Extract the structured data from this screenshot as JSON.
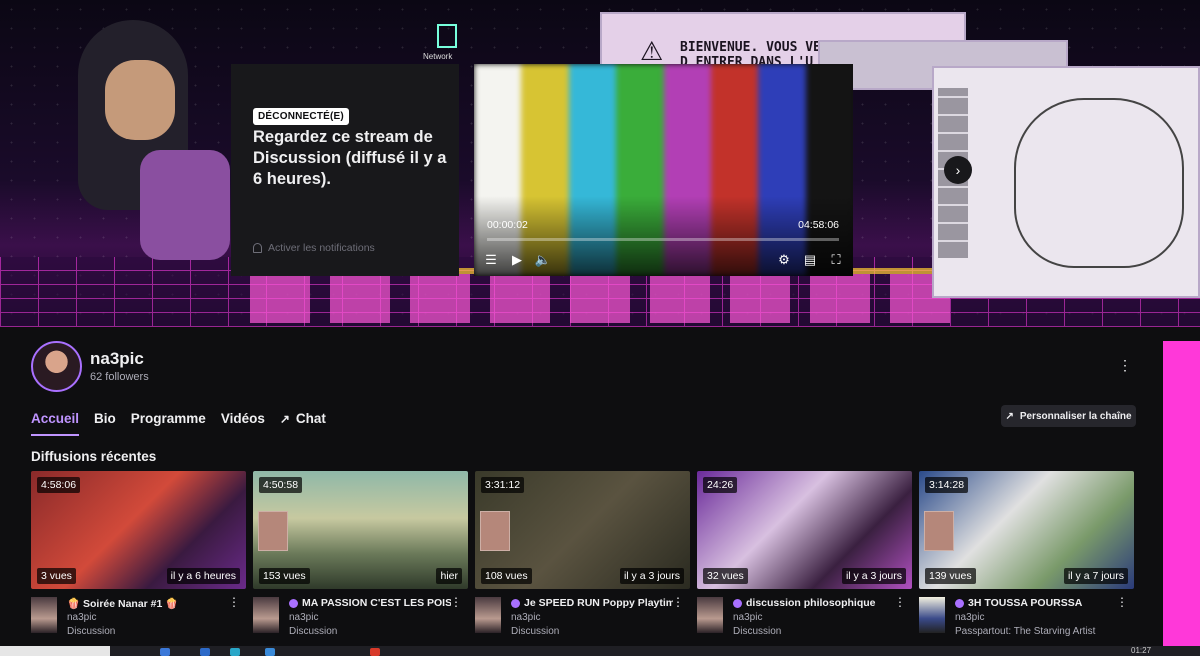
{
  "banner": {
    "window_text_line1": "BIENVENUE. VOUS VENE",
    "window_text_line2": "D ENTRER DANS L'U",
    "desktop_icon_label": "Network"
  },
  "offline_card": {
    "badge": "DÉCONNECTÉ(E)",
    "title": "Regardez ce stream de Discussion (diffusé il y a 6 heures).",
    "notify_label": "Activer les notifications"
  },
  "player": {
    "current_time": "00:00:02",
    "duration": "04:58:06",
    "progress_fraction": 0.0,
    "colors": [
      "#f4f4f0",
      "#d7c433",
      "#35b8d8",
      "#3aad3a",
      "#b23fb5",
      "#c2322a",
      "#2e3eb8",
      "#141414"
    ]
  },
  "channel": {
    "name": "na3pic",
    "followers": "62 followers",
    "tabs": [
      {
        "label": "Accueil",
        "active": true
      },
      {
        "label": "Bio",
        "active": false
      },
      {
        "label": "Programme",
        "active": false
      },
      {
        "label": "Vidéos",
        "active": false
      },
      {
        "label": "Chat",
        "active": false
      }
    ],
    "customize_label": "Personnaliser la chaîne",
    "section_title": "Diffusions récentes",
    "accent_color": "#bf94ff"
  },
  "videos": [
    {
      "duration": "4:58:06",
      "views": "3 vues",
      "ago": "il y a 6 heures",
      "title": "🍿 Soirée Nanar #1 🍿",
      "channel": "na3pic",
      "category": "Discussion",
      "dot": false,
      "thumb": "linear-gradient(135deg,#8a2a2a,#d24a3a 45%,#3a1a40 70%,#6a2a8a)"
    },
    {
      "duration": "4:50:58",
      "views": "153 vues",
      "ago": "hier",
      "title": "MA PASSION C'EST LES POISSONS",
      "channel": "na3pic",
      "category": "Discussion",
      "dot": true,
      "thumb": "linear-gradient(180deg,#8fb8a8,#c7c9a0 40%,#6b7a5a 70%,#2f3a2a)"
    },
    {
      "duration": "3:31:12",
      "views": "108 vues",
      "ago": "il y a 3 jours",
      "title": "Je SPEED RUN Poppy Playtime",
      "channel": "na3pic",
      "category": "Discussion",
      "dot": true,
      "thumb": "linear-gradient(135deg,#3a3a2a,#5a5340 50%,#2a2a20)"
    },
    {
      "duration": "24:26",
      "views": "32 vues",
      "ago": "il y a 3 jours",
      "title": "discussion philosophique",
      "channel": "na3pic",
      "category": "Discussion",
      "dot": true,
      "thumb": "linear-gradient(135deg,#6a2a9a,#d8c0e0 40%,#3a2040 70%,#b050c0)"
    },
    {
      "duration": "3:14:28",
      "views": "139 vues",
      "ago": "il y a 7 jours",
      "title": "3H TOUSSA POURSSA",
      "channel": "na3pic",
      "category": "Passpartout: The Starving Artist",
      "dot": true,
      "thumb": "linear-gradient(135deg,#2a4a8a,#e0e0e0 40%,#7a9a6a 70%,#2a3a7a)"
    }
  ],
  "taskbar": {
    "clock": "01:27"
  }
}
